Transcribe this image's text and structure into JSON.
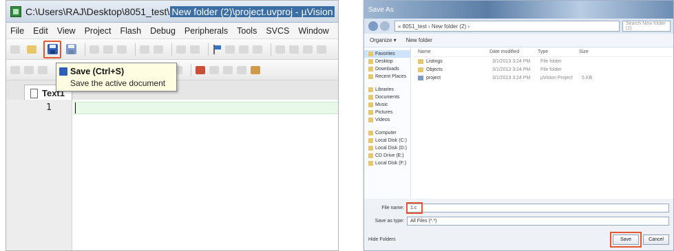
{
  "uvision": {
    "title_prefix": "C:\\Users\\RAJ\\Desktop\\8051_test\\",
    "title_selected": "New folder (2)\\project.uvproj - µVision",
    "menu": [
      "File",
      "Edit",
      "View",
      "Project",
      "Flash",
      "Debug",
      "Peripherals",
      "Tools",
      "SVCS",
      "Window"
    ],
    "tooltip": {
      "title": "Save (Ctrl+S)",
      "description": "Save the active document"
    },
    "tab_label": "Text1",
    "line_number": "1",
    "toolbar2_dropdown": "▾"
  },
  "save_dialog": {
    "title": "Save As",
    "address": "« 8051_test › New folder (2) ›",
    "search_placeholder": "Search New folder (2)",
    "commands": [
      "Organize ▾",
      "New folder"
    ],
    "nav_items": [
      {
        "label": "Favorites",
        "selected": true
      },
      {
        "label": "Desktop",
        "selected": false
      },
      {
        "label": "Downloads",
        "selected": false
      },
      {
        "label": "Recent Places",
        "selected": false
      },
      {
        "label": "",
        "gap": true
      },
      {
        "label": "Libraries",
        "selected": false
      },
      {
        "label": "Documents",
        "selected": false
      },
      {
        "label": "Music",
        "selected": false
      },
      {
        "label": "Pictures",
        "selected": false
      },
      {
        "label": "Videos",
        "selected": false
      },
      {
        "label": "",
        "gap": true
      },
      {
        "label": "Computer",
        "selected": false
      },
      {
        "label": "Local Disk (C:)",
        "selected": false
      },
      {
        "label": "Local Disk (D:)",
        "selected": false
      },
      {
        "label": "CD Drive (E:)",
        "selected": false
      },
      {
        "label": "Local Disk (F:)",
        "selected": false
      }
    ],
    "columns": {
      "name": "Name",
      "date": "Date modified",
      "type": "Type",
      "size": "Size"
    },
    "files": [
      {
        "name": "Listings",
        "date": "3/1/2013 3:24 PM",
        "type": "File folder",
        "size": ""
      },
      {
        "name": "Objects",
        "date": "3/1/2013 3:24 PM",
        "type": "File folder",
        "size": ""
      },
      {
        "name": "project",
        "date": "3/1/2013 3:24 PM",
        "type": "µVision Project",
        "size": "5 KB"
      }
    ],
    "file_name_label": "File name:",
    "file_name_value": "1.c",
    "save_type_label": "Save as type:",
    "save_type_value": "All Files (*.*)",
    "hide_folders": "Hide Folders",
    "save_button": "Save",
    "cancel_button": "Cancel"
  },
  "colors": {
    "highlight": "#e4572e",
    "tooltip_bg": "#fffde1",
    "current_line": "#e9f9e9"
  }
}
